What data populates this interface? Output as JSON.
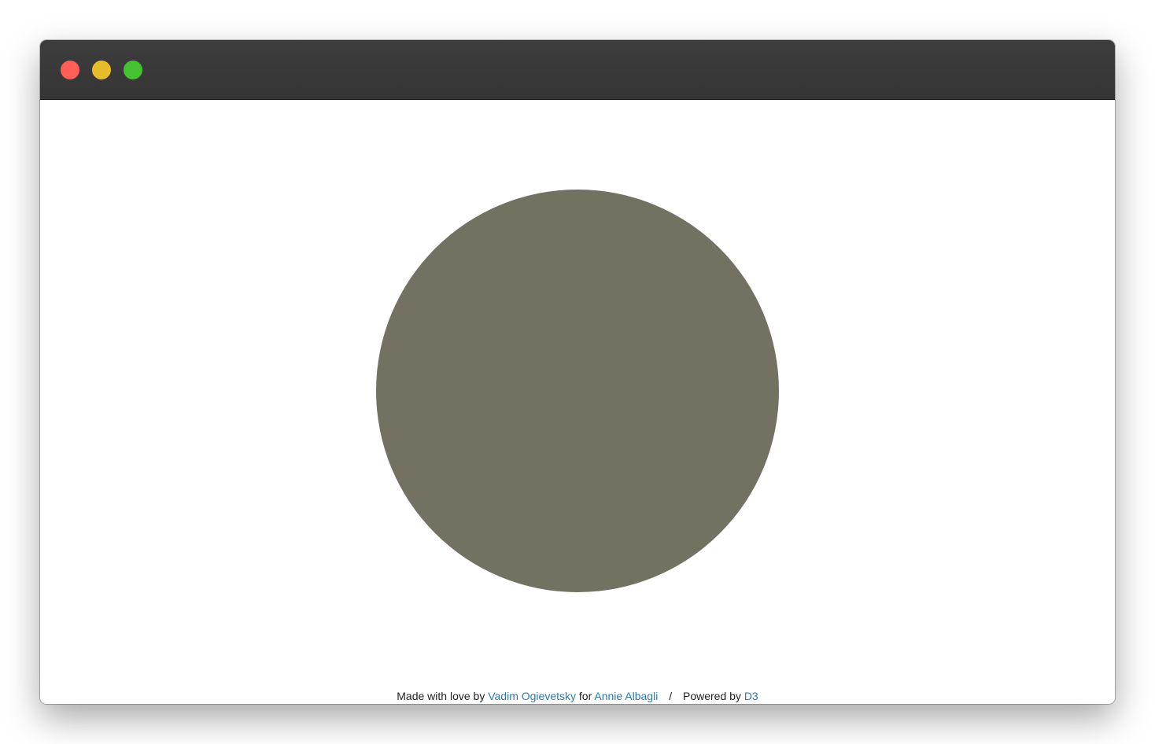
{
  "window": {
    "controls": [
      {
        "name": "close",
        "color": "#ff5f56"
      },
      {
        "name": "minimize",
        "color": "#e5bd2a"
      },
      {
        "name": "maximize",
        "color": "#45c22f"
      }
    ]
  },
  "canvas": {
    "bubble_color": "#737262"
  },
  "footer": {
    "made_with_love_prefix": "Made with love by",
    "author_link": "Vadim Ogievetsky",
    "for_text": "for",
    "recipient_link": "Annie Albagli",
    "separator": "/",
    "powered_by_prefix": "Powered by",
    "powered_by_link": "D3",
    "link_color": "#2a7ab0"
  }
}
